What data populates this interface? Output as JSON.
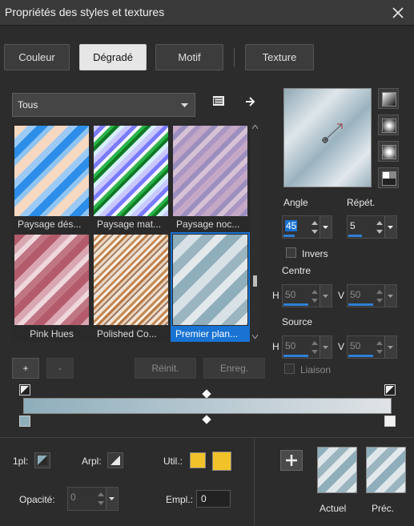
{
  "window": {
    "title": "Propriétés des styles et textures"
  },
  "tabs": [
    {
      "label": "Couleur"
    },
    {
      "label": "Dégradé"
    },
    {
      "label": "Motif"
    },
    {
      "label": "Texture"
    }
  ],
  "category": {
    "value": "Tous"
  },
  "gradients": [
    {
      "label": "Paysage dés..."
    },
    {
      "label": "Paysage mat..."
    },
    {
      "label": "Paysage noc..."
    },
    {
      "label": "Pink Hues"
    },
    {
      "label": "Polished Co..."
    },
    {
      "label": "Premier plan..."
    }
  ],
  "list_buttons": {
    "add": "+",
    "remove": "-",
    "reset": "Réinit.",
    "save": "Enreg."
  },
  "angle": {
    "label": "Angle",
    "value": "45"
  },
  "repeat": {
    "label": "Répét.",
    "value": "5"
  },
  "invert": {
    "label": "Invers"
  },
  "center": {
    "label": "Centre",
    "h_label": "H",
    "h_value": "50",
    "v_label": "V",
    "v_value": "50"
  },
  "source": {
    "label": "Source",
    "h_label": "H",
    "h_value": "50",
    "v_label": "V",
    "v_value": "50"
  },
  "link": {
    "label": "Liaison"
  },
  "bottom": {
    "fg_label": "1pl:",
    "bg_label": "Arpl:",
    "util_label": "Util.:",
    "opacity_label": "Opacité:",
    "opacity_value": "0",
    "location_label": "Empl.:",
    "location_value": "0",
    "current_label": "Actuel",
    "previous_label": "Préc."
  },
  "colors": {
    "accent": "#1873d3",
    "util_swatch": "#f2c22a",
    "gradient_start": "#8eaebb",
    "gradient_end": "#dfe3e6"
  }
}
